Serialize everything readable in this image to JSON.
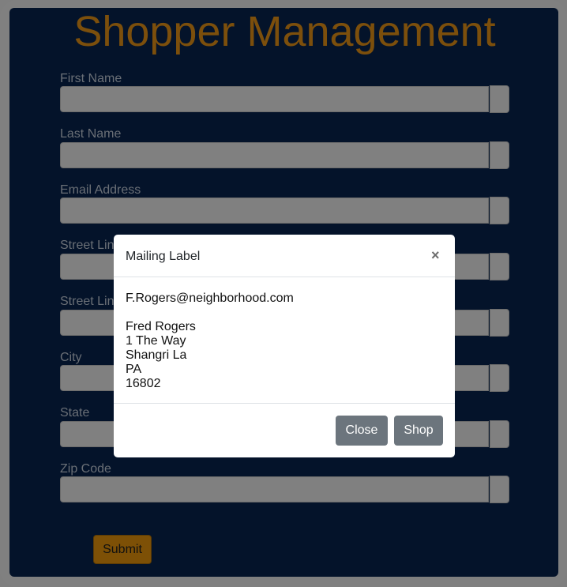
{
  "page": {
    "title": "Shopper Management"
  },
  "form": {
    "fields": [
      {
        "label": "First Name",
        "value": ""
      },
      {
        "label": "Last Name",
        "value": ""
      },
      {
        "label": "Email Address",
        "value": ""
      },
      {
        "label": "Street Line",
        "value": ""
      },
      {
        "label": "Street Line",
        "value": ""
      },
      {
        "label": "City",
        "value": ""
      },
      {
        "label": "State",
        "value": ""
      },
      {
        "label": "Zip Code",
        "value": ""
      }
    ],
    "submit_label": "Submit"
  },
  "modal": {
    "title": "Mailing Label",
    "close_icon": "×",
    "email": "F.Rogers@neighborhood.com",
    "name": "Fred Rogers",
    "street": "1 The Way",
    "city": "Shangri La",
    "state": "PA",
    "zip": "16802",
    "close_label": "Close",
    "shop_label": "Shop"
  },
  "colors": {
    "background": "#04132a",
    "title": "#7c4f0c",
    "submit": "#7d5006",
    "modal_button": "#6c757d"
  }
}
